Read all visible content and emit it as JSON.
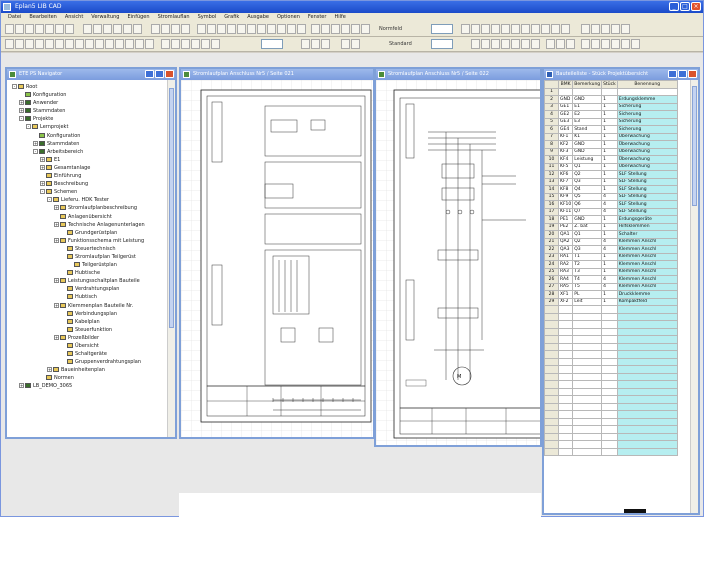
{
  "window": {
    "title": "Eplan5 LIB CAD",
    "buttons": [
      "_",
      "□",
      "×"
    ]
  },
  "menubar": {
    "items": [
      "Datei",
      "Bearbeiten",
      "Ansicht",
      "Verwaltung",
      "Einfügen",
      "Stromlauflan",
      "Symbol",
      "Grafik",
      "Ausgabe",
      "Optionen",
      "Fenster",
      "Hilfe"
    ]
  },
  "toolbar": {
    "label1": "Normfeld",
    "label2": "Standard"
  },
  "panels": {
    "tree_title": "ETE PS Navigator",
    "sheet1_title": "Stromlaufplan Anschluss Nr5 / Seite 021",
    "sheet2_title": "Stromlaufplan Anschluss Nr5 / Seite 022",
    "list_title": "Bauteileliste - Stück Projektübersicht"
  },
  "tree": [
    {
      "label": "Root",
      "indent": 0,
      "exp": "-",
      "color": "#e8c85a"
    },
    {
      "label": "Konfiguration",
      "indent": 1,
      "exp": "",
      "color": "#8bc44a"
    },
    {
      "label": "Anwender",
      "indent": 1,
      "exp": "+",
      "color": "#3a6e2c"
    },
    {
      "label": "Stammdaten",
      "indent": 1,
      "exp": "+",
      "color": "#3a6e2c"
    },
    {
      "label": "Projekte",
      "indent": 1,
      "exp": "-",
      "color": "#3a6e2c"
    },
    {
      "label": "Lernprojekt",
      "indent": 2,
      "exp": "-",
      "color": "#e8c85a"
    },
    {
      "label": "Konfiguration",
      "indent": 3,
      "exp": "",
      "color": "#8bc44a"
    },
    {
      "label": "Stammdaten",
      "indent": 3,
      "exp": "+",
      "color": "#3a6e2c"
    },
    {
      "label": "Arbeitsbereich",
      "indent": 3,
      "exp": "-",
      "color": "#3a6e2c"
    },
    {
      "label": "E1",
      "indent": 4,
      "exp": "+",
      "color": "#e8c85a"
    },
    {
      "label": "Gesamtanlage",
      "indent": 4,
      "exp": "+",
      "color": "#e8c85a"
    },
    {
      "label": "Einführung",
      "indent": 4,
      "exp": "",
      "color": "#e8c85a"
    },
    {
      "label": "Beschreibung",
      "indent": 4,
      "exp": "+",
      "color": "#e8c85a"
    },
    {
      "label": "Schemen",
      "indent": 4,
      "exp": "-",
      "color": "#e8c85a"
    },
    {
      "label": "Lieferu. HDK Tester",
      "indent": 5,
      "exp": "-",
      "color": "#e8c85a"
    },
    {
      "label": "Stromlaufplanbeschreibung",
      "indent": 6,
      "exp": "+",
      "color": "#e8c85a"
    },
    {
      "label": "Anlagenübersicht",
      "indent": 6,
      "exp": "",
      "color": "#e8c85a"
    },
    {
      "label": "Technische Anlagenunterlagen",
      "indent": 6,
      "exp": "+",
      "color": "#e8c85a"
    },
    {
      "label": "Grundgerüstplan",
      "indent": 7,
      "exp": "",
      "color": "#e8c85a"
    },
    {
      "label": "Funktionsschema mit Leistung",
      "indent": 6,
      "exp": "+",
      "color": "#e8c85a"
    },
    {
      "label": "Steuertechnisch",
      "indent": 7,
      "exp": "",
      "color": "#e8c85a"
    },
    {
      "label": "Stromlaufplan Teilgerüst",
      "indent": 7,
      "exp": "",
      "color": "#e8c85a"
    },
    {
      "label": "Teilgerüstplan",
      "indent": 8,
      "exp": "",
      "color": "#e8c85a"
    },
    {
      "label": "Hubtische",
      "indent": 7,
      "exp": "",
      "color": "#e8c85a"
    },
    {
      "label": "Leistungsschaltplan Bauteile",
      "indent": 6,
      "exp": "+",
      "color": "#e8c85a"
    },
    {
      "label": "Verdrahtungsplan",
      "indent": 7,
      "exp": "",
      "color": "#e8c85a"
    },
    {
      "label": "Hubtisch",
      "indent": 7,
      "exp": "",
      "color": "#e8c85a"
    },
    {
      "label": "Klemmenplan Bauteile Nr.",
      "indent": 6,
      "exp": "+",
      "color": "#e8c85a"
    },
    {
      "label": "Verbindungsplan",
      "indent": 7,
      "exp": "",
      "color": "#e8c85a"
    },
    {
      "label": "Kabelplan",
      "indent": 7,
      "exp": "",
      "color": "#e8c85a"
    },
    {
      "label": "Steuerfunktion",
      "indent": 7,
      "exp": "",
      "color": "#e8c85a"
    },
    {
      "label": "Prozeßbilder",
      "indent": 6,
      "exp": "+",
      "color": "#e8c85a"
    },
    {
      "label": "Übersicht",
      "indent": 7,
      "exp": "",
      "color": "#e8c85a"
    },
    {
      "label": "Schaltgeräte",
      "indent": 7,
      "exp": "",
      "color": "#e8c85a"
    },
    {
      "label": "Gruppenverdrahtungsplan",
      "indent": 7,
      "exp": "",
      "color": "#e8c85a"
    },
    {
      "label": "Baueinheitenplan",
      "indent": 5,
      "exp": "+",
      "color": "#e8c85a"
    },
    {
      "label": "Normen",
      "indent": 4,
      "exp": "",
      "color": "#e8c85a"
    },
    {
      "label": "LB_DEMO_3065",
      "indent": 1,
      "exp": "+",
      "color": "#3a6e2c"
    }
  ],
  "list": {
    "headers": [
      "",
      "BMK",
      "Bemerkung",
      "Stück",
      "Benennung"
    ],
    "rows": [
      [
        "1",
        "",
        "",
        "",
        ""
      ],
      [
        "2",
        "GND",
        "GND",
        "1",
        "Erdungsklemme"
      ],
      [
        "3",
        "GE1",
        "E1",
        "1",
        "Sicherung"
      ],
      [
        "4",
        "GE2",
        "E2",
        "1",
        "Sicherung"
      ],
      [
        "5",
        "GE3",
        "E3",
        "1",
        "Sicherung"
      ],
      [
        "6",
        "GE4",
        "Stand",
        "1",
        "Sicherung"
      ],
      [
        "7",
        "KF1",
        "K1",
        "1",
        "Überwachung"
      ],
      [
        "8",
        "KF2",
        "GND",
        "1",
        "Überwachung"
      ],
      [
        "9",
        "KF3",
        "GND",
        "1",
        "Überwachung"
      ],
      [
        "10",
        "KF4",
        "Leistung",
        "1",
        "Überwachung"
      ],
      [
        "11",
        "KF5",
        "Q1",
        "1",
        "Überwachung"
      ],
      [
        "12",
        "KF6",
        "Q2",
        "1",
        "SLF Stellung"
      ],
      [
        "13",
        "KF7",
        "Q3",
        "1",
        "SLF Stellung"
      ],
      [
        "14",
        "KF8",
        "Q4",
        "1",
        "SLF Stellung"
      ],
      [
        "15",
        "KF9",
        "Q5",
        "4",
        "SLF Stellung"
      ],
      [
        "16",
        "KF10",
        "Q6",
        "4",
        "SLF Stellung"
      ],
      [
        "17",
        "KF11",
        "Q7",
        "4",
        "SLF Stellung"
      ],
      [
        "18",
        "PE1",
        "GND",
        "1",
        "Erdungsgeräte"
      ],
      [
        "19",
        "PE2",
        "Z. bat",
        "1",
        "Hilfsklemmen"
      ],
      [
        "20",
        "QA1",
        "Q1",
        "1",
        "Schalter"
      ],
      [
        "21",
        "QA2",
        "Q2",
        "4",
        "Klemmen Anschl"
      ],
      [
        "22",
        "QA3",
        "Q3",
        "4",
        "Klemmen Anschl"
      ],
      [
        "23",
        "RA1",
        "T1",
        "1",
        "Klemmen Anschl"
      ],
      [
        "24",
        "RA2",
        "T2",
        "1",
        "Klemmen Anschl"
      ],
      [
        "25",
        "RA3",
        "T3",
        "1",
        "Klemmen Anschl"
      ],
      [
        "26",
        "RA4",
        "T4",
        "4",
        "Klemmen Anschl"
      ],
      [
        "27",
        "RA5",
        "T5",
        "4",
        "Klemmen Anschl"
      ],
      [
        "28",
        "XF1",
        "PL",
        "1",
        "Druckklemme"
      ],
      [
        "29",
        "XF2",
        "Leit",
        "1",
        "Kompaktfeld"
      ]
    ],
    "empty_rows": 20
  },
  "colors": {
    "titlebar": "#1b4bc9",
    "panel_border": "#7fa0d8",
    "cyan_cell": "#b6eef0"
  }
}
